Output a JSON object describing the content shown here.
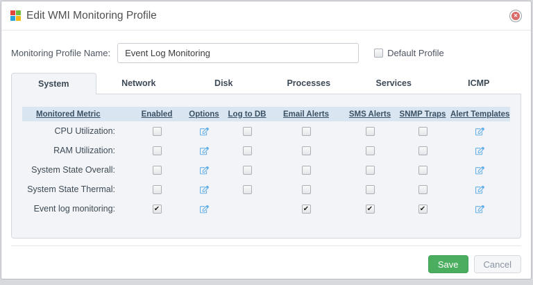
{
  "dialog": {
    "title": "Edit WMI Monitoring Profile"
  },
  "form": {
    "profile_name_label": "Monitoring Profile Name:",
    "profile_name_value": "Event Log Monitoring",
    "default_profile_label": "Default Profile",
    "default_profile_checked": false
  },
  "tabs": [
    {
      "label": "System",
      "active": true
    },
    {
      "label": "Network",
      "active": false
    },
    {
      "label": "Disk",
      "active": false
    },
    {
      "label": "Processes",
      "active": false
    },
    {
      "label": "Services",
      "active": false
    },
    {
      "label": "ICMP",
      "active": false
    }
  ],
  "table": {
    "headers": [
      "Monitored Metric",
      "Enabled",
      "Options",
      "Log to DB",
      "Email Alerts",
      "SMS Alerts",
      "SNMP Traps",
      "Alert Templates"
    ],
    "rows": [
      {
        "metric": "CPU Utilization:",
        "enabled": false,
        "options": true,
        "log_to_db": false,
        "email_alerts": false,
        "sms_alerts": false,
        "snmp_traps": false,
        "alert_templates": true
      },
      {
        "metric": "RAM Utilization:",
        "enabled": false,
        "options": true,
        "log_to_db": false,
        "email_alerts": false,
        "sms_alerts": false,
        "snmp_traps": false,
        "alert_templates": true
      },
      {
        "metric": "System State Overall:",
        "enabled": false,
        "options": true,
        "log_to_db": false,
        "email_alerts": false,
        "sms_alerts": false,
        "snmp_traps": false,
        "alert_templates": true
      },
      {
        "metric": "System State Thermal:",
        "enabled": false,
        "options": true,
        "log_to_db": false,
        "email_alerts": false,
        "sms_alerts": false,
        "snmp_traps": false,
        "alert_templates": true
      },
      {
        "metric": "Event log monitoring:",
        "enabled": true,
        "options": true,
        "log_to_db": null,
        "email_alerts": true,
        "sms_alerts": true,
        "snmp_traps": true,
        "alert_templates": true
      }
    ]
  },
  "footer": {
    "save_label": "Save",
    "cancel_label": "Cancel"
  },
  "icons": {
    "check_glyph": "✔",
    "close_glyph": "✕",
    "edit": "edit-icon"
  },
  "colors": {
    "save_green": "#4bae5e",
    "edit_blue": "#66b0e8",
    "close_red": "#d96a6a",
    "header_row_bg": "#d9e5f0",
    "logo_red": "#e2453c",
    "logo_green": "#6fbe44",
    "logo_blue": "#29a3dc",
    "logo_yellow": "#f5b917"
  }
}
